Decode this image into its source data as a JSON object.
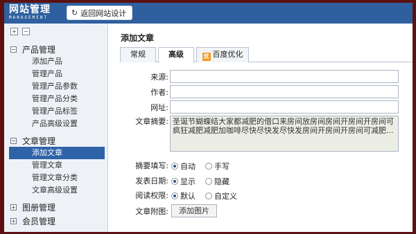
{
  "header": {
    "logo_main": "网站管理",
    "logo_sub": "MANAGEMENT",
    "back_button_label": "返回网站设计",
    "back_icon": "refresh-icon"
  },
  "sidebar": {
    "tools": [
      "+",
      "−"
    ],
    "groups": [
      {
        "title": "产品管理",
        "expanded": true,
        "items": [
          "添加产品",
          "管理产品",
          "管理产品参数",
          "管理产品分类",
          "管理产品标签",
          "产品高级设置"
        ]
      },
      {
        "title": "文章管理",
        "expanded": true,
        "items": [
          "添加文章",
          "管理文章",
          "管理文章分类",
          "文章高级设置"
        ],
        "active_item": "添加文章"
      },
      {
        "title": "图册管理",
        "expanded": false,
        "items": []
      },
      {
        "title": "会员管理",
        "expanded": false,
        "items": []
      }
    ]
  },
  "main": {
    "title": "添加文章",
    "tabs": [
      {
        "label": "常规",
        "active": false
      },
      {
        "label": "高级",
        "active": true
      },
      {
        "label": "百度优化",
        "active": false,
        "icon": "seo-icon",
        "icon_text": "优"
      }
    ],
    "form": {
      "source_label": "来源:",
      "source_value": "",
      "author_label": "作者:",
      "author_value": "",
      "url_label": "网址:",
      "url_value": "",
      "summary_label": "文章摘要:",
      "summary_value": "圣诞节蝴蝶结大家都减肥的借口来房间放房间房间开房间开房间可疯狂减肥减肥加咖啡尽快尽快发尽快发房间开房间开房间可减肥...",
      "summary_fill_label": "摘要填写:",
      "summary_fill_options": [
        "自动",
        "手写"
      ],
      "summary_fill_selected": "自动",
      "publish_date_label": "发表日期:",
      "publish_date_options": [
        "显示",
        "隐藏"
      ],
      "publish_date_selected": "显示",
      "read_perm_label": "阅读权限:",
      "read_perm_options": [
        "默认",
        "自定义"
      ],
      "read_perm_selected": "默认",
      "attachment_label": "文章附图:",
      "attachment_button": "添加图片"
    }
  },
  "colors": {
    "topbar": "#2f5f9e",
    "active_item": "#2f63a8",
    "outer_frame": "#5c1010",
    "seo_icon": "#f39a1e"
  }
}
